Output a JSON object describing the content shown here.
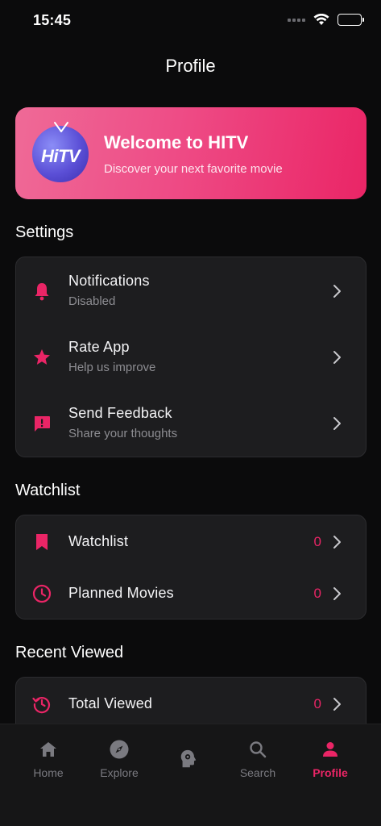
{
  "status_bar": {
    "time": "15:45"
  },
  "header": {
    "title": "Profile"
  },
  "hero": {
    "logo_text": "HiTV",
    "title": "Welcome to HITV",
    "subtitle": "Discover your next favorite movie"
  },
  "settings": {
    "section_title": "Settings",
    "items": [
      {
        "icon": "bell-icon",
        "title": "Notifications",
        "subtitle": "Disabled"
      },
      {
        "icon": "star-icon",
        "title": "Rate App",
        "subtitle": "Help us improve"
      },
      {
        "icon": "feedback-icon",
        "title": "Send Feedback",
        "subtitle": "Share your thoughts"
      }
    ]
  },
  "watchlist": {
    "section_title": "Watchlist",
    "items": [
      {
        "icon": "bookmark-icon",
        "title": "Watchlist",
        "count": "0"
      },
      {
        "icon": "clock-icon",
        "title": "Planned Movies",
        "count": "0"
      }
    ]
  },
  "recent": {
    "section_title": "Recent Viewed",
    "items": [
      {
        "icon": "history-icon",
        "title": "Total Viewed",
        "count": "0"
      }
    ]
  },
  "tabs": [
    {
      "icon": "home-icon",
      "label": "Home",
      "active": false
    },
    {
      "icon": "compass-icon",
      "label": "Explore",
      "active": false
    },
    {
      "icon": "ai-head-icon",
      "label": "",
      "active": false
    },
    {
      "icon": "search-icon",
      "label": "Search",
      "active": false
    },
    {
      "icon": "person-icon",
      "label": "Profile",
      "active": true
    }
  ],
  "colors": {
    "accent": "#ea2566",
    "background": "#0b0b0c",
    "card": "#1d1d1f",
    "muted": "#8d8d92"
  }
}
